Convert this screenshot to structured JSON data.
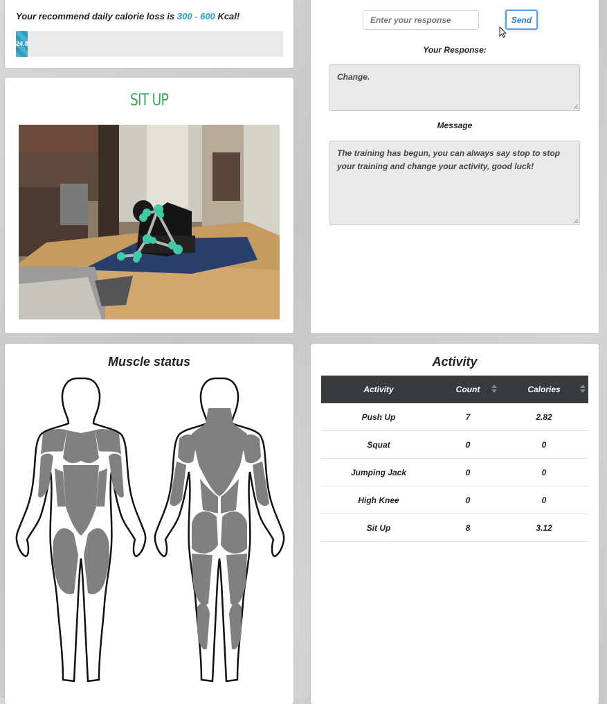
{
  "calories": {
    "text_prefix": "Your recommend daily calorie loss is ",
    "range": "300 - 600",
    "unit": " Kcal!",
    "progress_label": "24.8",
    "progress_fraction": 0.045
  },
  "exercise": {
    "title": "SIT UP"
  },
  "chat": {
    "input_placeholder": "Enter your response",
    "send_label": "Send",
    "response_label": "Your Response:",
    "response_text": "Change.",
    "message_label": "Message",
    "message_text": "The training has begun, you can always say stop to stop your training and change your activity, good luck!"
  },
  "muscle": {
    "title": "Muscle status"
  },
  "activity": {
    "title": "Activity",
    "columns": [
      "Activity",
      "Count",
      "Calories"
    ],
    "rows": [
      [
        "Push Up",
        "7",
        "2.82"
      ],
      [
        "Squat",
        "0",
        "0"
      ],
      [
        "Jumping Jack",
        "0",
        "0"
      ],
      [
        "High Knee",
        "0",
        "0"
      ],
      [
        "Sit Up",
        "8",
        "3.12"
      ]
    ]
  },
  "colors": {
    "accent": "#2a9fc4",
    "title_green": "#3aa757",
    "table_header": "#363b40",
    "muscle_fill": "#808080",
    "pose_marker": "#40c9a2"
  }
}
